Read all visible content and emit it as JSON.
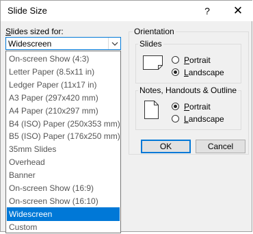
{
  "window": {
    "title": "Slide Size",
    "help_glyph": "?",
    "close_glyph": "✕"
  },
  "slides_sized_for": {
    "label_underlined": "S",
    "label_rest": "lides sized for:",
    "value": "Widescreen",
    "options": [
      "On-screen Show (4:3)",
      "Letter Paper (8.5x11 in)",
      "Ledger Paper (11x17 in)",
      "A3 Paper (297x420 mm)",
      "A4 Paper (210x297 mm)",
      "B4 (ISO) Paper (250x353 mm)",
      "B5 (ISO) Paper (176x250 mm)",
      "35mm Slides",
      "Overhead",
      "Banner",
      "On-screen Show (16:9)",
      "On-screen Show (16:10)",
      "Widescreen",
      "Custom"
    ],
    "selected_option": "Widescreen"
  },
  "orientation": {
    "label": "Orientation",
    "slides": {
      "label": "Slides",
      "portrait_u": "P",
      "portrait_rest": "ortrait",
      "landscape_u": "L",
      "landscape_rest": "andscape",
      "selected": "Landscape"
    },
    "notes": {
      "label": "Notes, Handouts & Outline",
      "portrait_u": "P",
      "portrait_rest": "ortrait",
      "landscape_u": "L",
      "landscape_rest": "andscape",
      "selected": "Portrait"
    }
  },
  "buttons": {
    "ok": "OK",
    "cancel": "Cancel"
  },
  "colors": {
    "accent": "#0078d7",
    "dialog_bg": "#f0f0f0"
  },
  "icons": {
    "combo_arrow": "chevron-down-icon",
    "slides_orientation": "landscape-page-icon",
    "notes_orientation": "portrait-page-icon"
  }
}
